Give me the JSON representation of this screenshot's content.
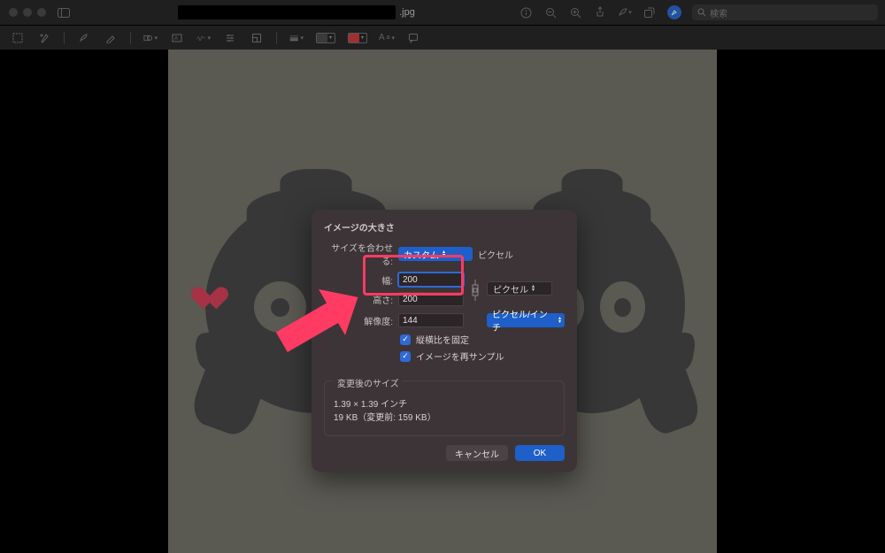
{
  "titlebar": {
    "file_extension": ".jpg",
    "search_placeholder": "検索"
  },
  "dialog": {
    "title": "イメージの大きさ",
    "fit_into_label": "サイズを合わせる:",
    "fit_into_value": "カスタム",
    "fit_into_unit": "ピクセル",
    "width_label": "幅:",
    "width_value": "200",
    "height_label": "高さ:",
    "height_value": "200",
    "dimension_unit": "ピクセル",
    "resolution_label": "解像度:",
    "resolution_value": "144",
    "resolution_unit": "ピクセル/インチ",
    "scale_proportionally_label": "縦横比を固定",
    "resample_label": "イメージを再サンプル",
    "resulting_size_title": "変更後のサイズ",
    "resulting_dimensions": "1.39 × 1.39 インチ",
    "resulting_filesize": "19 KB（変更前: 159 KB）",
    "cancel_label": "キャンセル",
    "ok_label": "OK"
  },
  "annotation": {
    "highlighted_fields": [
      "width-input",
      "height-input"
    ],
    "arrow_points_to": "width-input",
    "color": "#ff3b63"
  }
}
